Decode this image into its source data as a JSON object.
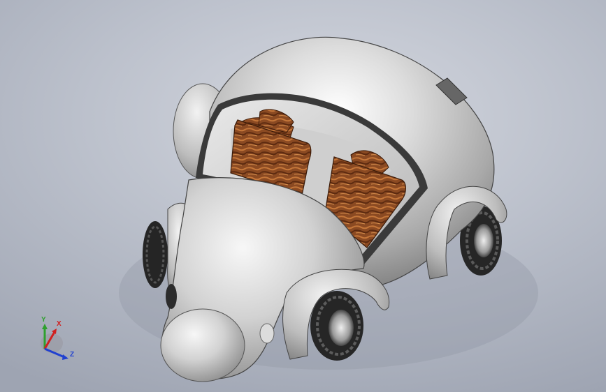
{
  "viewport": {
    "background_top": "#d4d7df",
    "background_bottom": "#9ea4b2"
  },
  "model": {
    "body_color": "#c8c8c8",
    "seat_color": "#8b4a22",
    "tire_color": "#2a2a2a"
  },
  "triad": {
    "y_label": "Y",
    "x_label": "X",
    "z_label": "Z",
    "y_color": "#2ea02e",
    "x_color": "#d02020",
    "z_color": "#2040d0"
  }
}
